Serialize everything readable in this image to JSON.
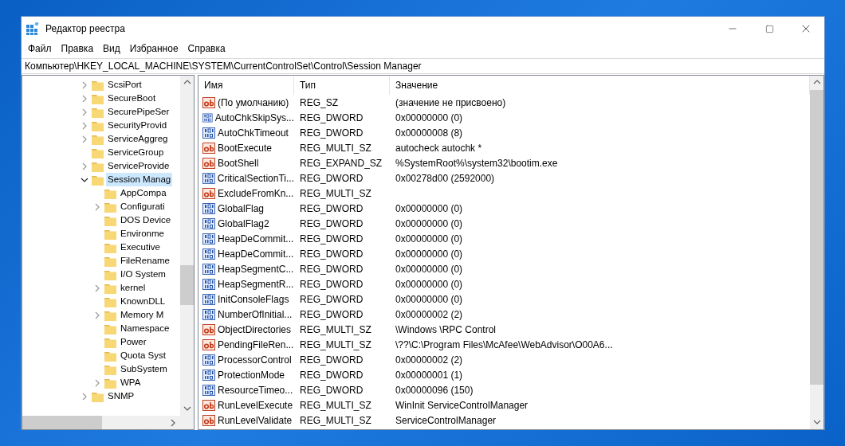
{
  "window": {
    "title": "Редактор реестра"
  },
  "menu": [
    "Файл",
    "Правка",
    "Вид",
    "Избранное",
    "Справка"
  ],
  "address": "Компьютер\\HKEY_LOCAL_MACHINE\\SYSTEM\\CurrentControlSet\\Control\\Session Manager",
  "tree": [
    {
      "label": "ScsiPort",
      "has_children": true,
      "selected": false
    },
    {
      "label": "SecureBoot",
      "has_children": true,
      "selected": false
    },
    {
      "label": "SecurePipeSer",
      "has_children": true,
      "selected": false
    },
    {
      "label": "SecurityProvid",
      "has_children": true,
      "selected": false
    },
    {
      "label": "ServiceAggreg",
      "has_children": true,
      "selected": false
    },
    {
      "label": "ServiceGroup",
      "has_children": false,
      "selected": false
    },
    {
      "label": "ServiceProvide",
      "has_children": true,
      "selected": false
    },
    {
      "label": "Session Manag",
      "has_children": true,
      "expanded": true,
      "selected": true,
      "children": [
        {
          "label": "AppCompa",
          "has_children": false,
          "selected": false
        },
        {
          "label": "Configurati",
          "has_children": true,
          "selected": false
        },
        {
          "label": "DOS Device",
          "has_children": false,
          "selected": false
        },
        {
          "label": "Environme",
          "has_children": false,
          "selected": false
        },
        {
          "label": "Executive",
          "has_children": false,
          "selected": false
        },
        {
          "label": "FileRename",
          "has_children": false,
          "selected": false
        },
        {
          "label": "I/O System",
          "has_children": false,
          "selected": false
        },
        {
          "label": "kernel",
          "has_children": true,
          "selected": false
        },
        {
          "label": "KnownDLL",
          "has_children": false,
          "selected": false
        },
        {
          "label": "Memory M",
          "has_children": true,
          "selected": false
        },
        {
          "label": "Namespace",
          "has_children": false,
          "selected": false
        },
        {
          "label": "Power",
          "has_children": false,
          "selected": false
        },
        {
          "label": "Quota Syst",
          "has_children": false,
          "selected": false
        },
        {
          "label": "SubSystem",
          "has_children": false,
          "selected": false
        },
        {
          "label": "WPA",
          "has_children": true,
          "selected": false
        }
      ]
    },
    {
      "label": "SNMP",
      "has_children": true,
      "selected": false
    }
  ],
  "table": {
    "columns": [
      "Имя",
      "Тип",
      "Значение"
    ],
    "rows": [
      {
        "kind": "string",
        "name": "(По умолчанию)",
        "type": "REG_SZ",
        "value": "(значение не присвоено)"
      },
      {
        "kind": "binary",
        "name": "AutoChkSkipSys...",
        "type": "REG_DWORD",
        "value": "0x00000000 (0)"
      },
      {
        "kind": "binary",
        "name": "AutoChkTimeout",
        "type": "REG_DWORD",
        "value": "0x00000008 (8)"
      },
      {
        "kind": "string",
        "name": "BootExecute",
        "type": "REG_MULTI_SZ",
        "value": "autocheck autochk *"
      },
      {
        "kind": "string",
        "name": "BootShell",
        "type": "REG_EXPAND_SZ",
        "value": "%SystemRoot%\\system32\\bootim.exe"
      },
      {
        "kind": "binary",
        "name": "CriticalSectionTi...",
        "type": "REG_DWORD",
        "value": "0x00278d00 (2592000)"
      },
      {
        "kind": "string",
        "name": "ExcludeFromKn...",
        "type": "REG_MULTI_SZ"
      },
      {
        "kind": "binary",
        "name": "GlobalFlag",
        "type": "REG_DWORD",
        "value": "0x00000000 (0)"
      },
      {
        "kind": "binary",
        "name": "GlobalFlag2",
        "type": "REG_DWORD",
        "value": "0x00000000 (0)"
      },
      {
        "kind": "binary",
        "name": "HeapDeCommit...",
        "type": "REG_DWORD",
        "value": "0x00000000 (0)"
      },
      {
        "kind": "binary",
        "name": "HeapDeCommit...",
        "type": "REG_DWORD",
        "value": "0x00000000 (0)"
      },
      {
        "kind": "binary",
        "name": "HeapSegmentC...",
        "type": "REG_DWORD",
        "value": "0x00000000 (0)"
      },
      {
        "kind": "binary",
        "name": "HeapSegmentR...",
        "type": "REG_DWORD",
        "value": "0x00000000 (0)"
      },
      {
        "kind": "binary",
        "name": "InitConsoleFlags",
        "type": "REG_DWORD",
        "value": "0x00000000 (0)"
      },
      {
        "kind": "binary",
        "name": "NumberOfInitial...",
        "type": "REG_DWORD",
        "value": "0x00000002 (2)"
      },
      {
        "kind": "string",
        "name": "ObjectDirectories",
        "type": "REG_MULTI_SZ",
        "value": "\\Windows \\RPC Control"
      },
      {
        "kind": "string",
        "name": "PendingFileRen...",
        "type": "REG_MULTI_SZ",
        "value": "\\??\\C:\\Program Files\\McAfee\\WebAdvisor\\O00A6..."
      },
      {
        "kind": "binary",
        "name": "ProcessorControl",
        "type": "REG_DWORD",
        "value": "0x00000002 (2)"
      },
      {
        "kind": "binary",
        "name": "ProtectionMode",
        "type": "REG_DWORD",
        "value": "0x00000001 (1)"
      },
      {
        "kind": "binary",
        "name": "ResourceTimeo...",
        "type": "REG_DWORD",
        "value": "0x00000096 (150)"
      },
      {
        "kind": "string",
        "name": "RunLevelExecute",
        "type": "REG_MULTI_SZ",
        "value": "WinInit ServiceControlManager"
      },
      {
        "kind": "string",
        "name": "RunLevelValidate",
        "type": "REG_MULTI_SZ",
        "value": "ServiceControlManager"
      }
    ]
  }
}
